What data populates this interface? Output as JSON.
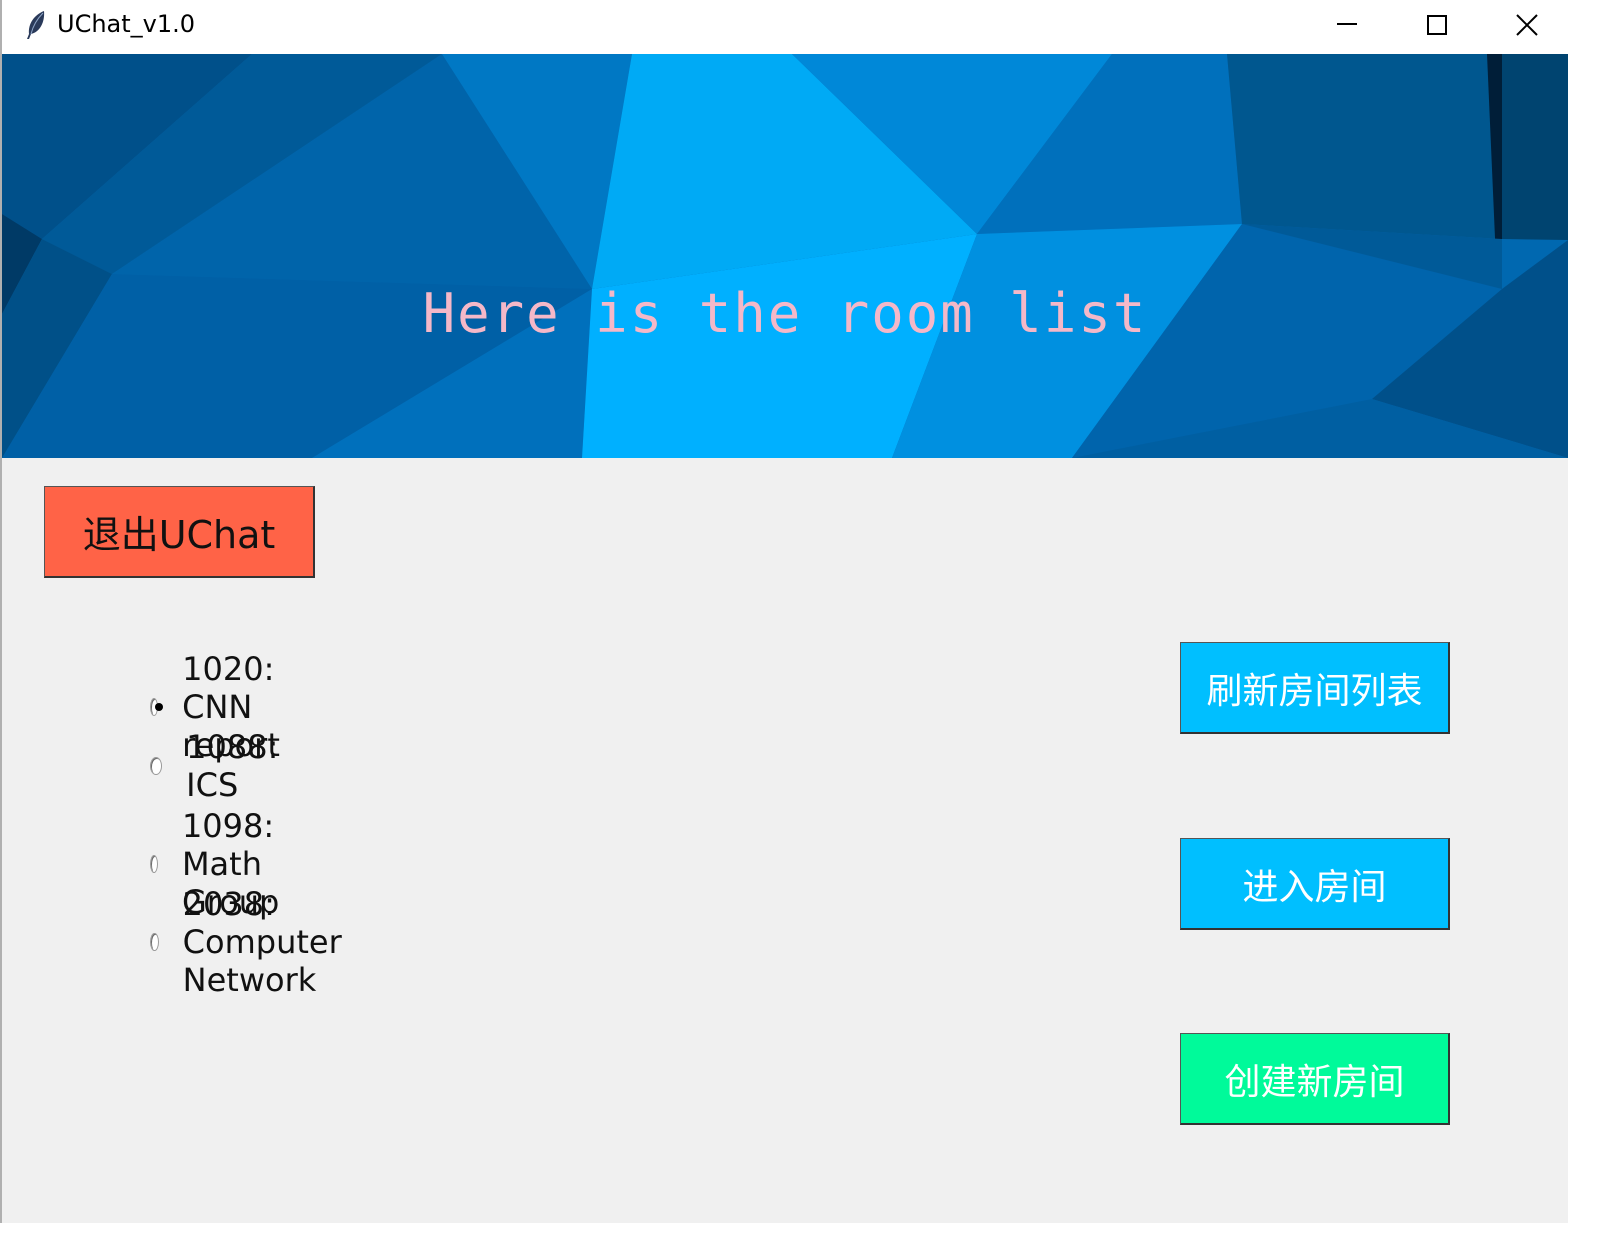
{
  "window": {
    "title": "UChat_v1.0",
    "icon": "feather-icon"
  },
  "banner": {
    "text": "Here is the room list"
  },
  "buttons": {
    "exit": "退出UChat",
    "refresh": "刷新房间列表",
    "enter": "进入房间",
    "create": "创建新房间"
  },
  "rooms": [
    {
      "label": "1020: CNN report",
      "selected": true
    },
    {
      "label": "1088: ICS",
      "selected": false
    },
    {
      "label": "1098: Math Group",
      "selected": false
    },
    {
      "label": "2038: Computer Network",
      "selected": false
    }
  ],
  "colors": {
    "exit_button": "#ff6347",
    "primary_button": "#00bfff",
    "create_button": "#00fa9a",
    "banner_text": "#f4b8c8"
  }
}
